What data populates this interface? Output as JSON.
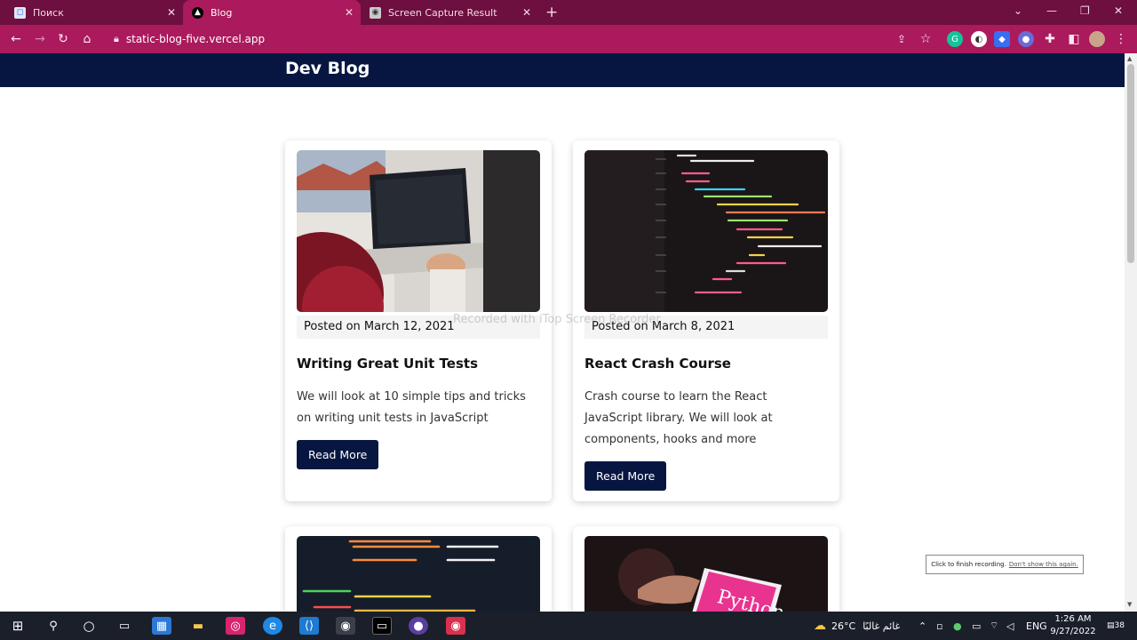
{
  "browser": {
    "tabs": [
      {
        "label": "Поиск",
        "icon": "search-page-icon"
      },
      {
        "label": "Blog",
        "icon": "vercel-triangle-icon"
      },
      {
        "label": "Screen Capture Result",
        "icon": "camera-icon"
      }
    ],
    "active_tab": 1,
    "url": "static-blog-five.vercel.app"
  },
  "site": {
    "logo": "Dev Blog",
    "posts": [
      {
        "date": "Posted on March 12, 2021",
        "title": "Writing Great Unit Tests",
        "excerpt": "We will look at 10 simple tips and tricks on writing unit tests in JavaScript",
        "button": "Read More"
      },
      {
        "date": "Posted on March 8, 2021",
        "title": "React Crash Course",
        "excerpt": "Crash course to learn the React JavaScript library. We will look at components, hooks and more",
        "button": "Read More"
      }
    ]
  },
  "overlay": {
    "watermark": "Recorded with iTop Screen Recorder",
    "rec_tip": "Click to finish recording.",
    "rec_tip_link": "Don't show this again."
  },
  "taskbar": {
    "weather": "26°C",
    "weather_text": "غائم غالبًا",
    "language": "ENG",
    "time": "1:26 AM",
    "date": "9/27/2022",
    "notifications": "38"
  },
  "colors": {
    "tabstrip": "#6d0f3f",
    "toolbar": "#ab1a5c",
    "site_header": "#071641",
    "button": "#071641"
  }
}
